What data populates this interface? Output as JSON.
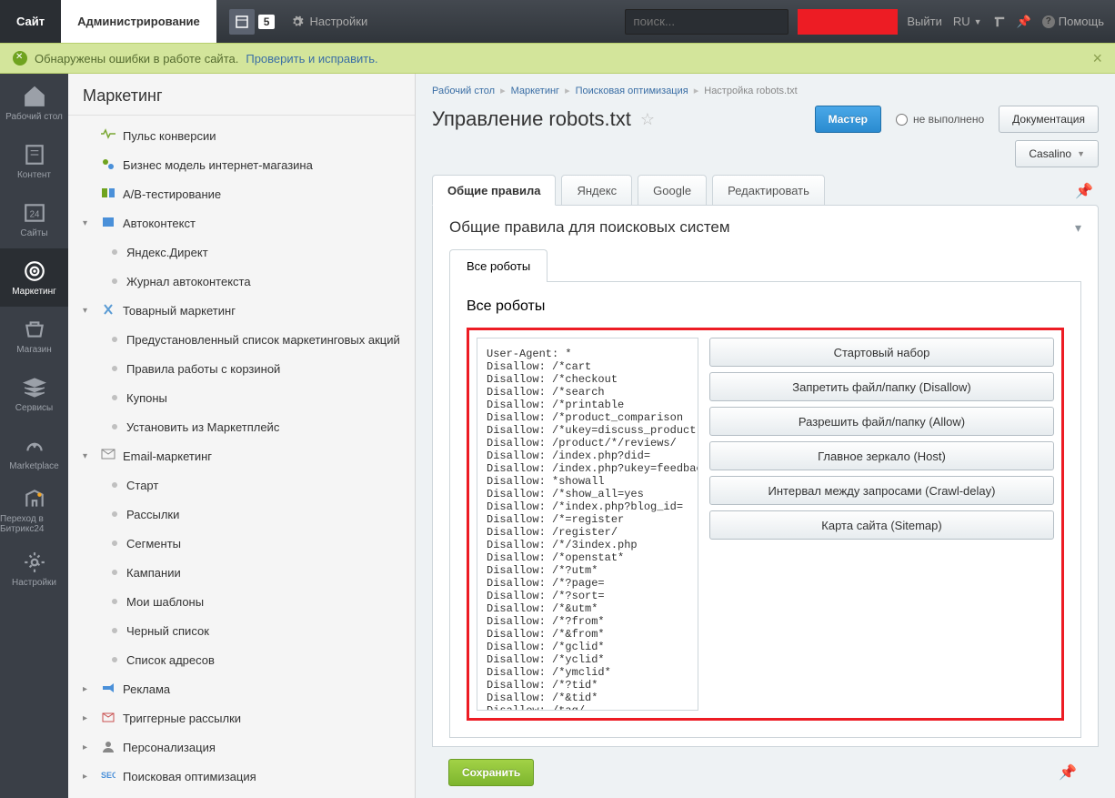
{
  "topbar": {
    "site_tab": "Сайт",
    "admin_tab": "Администрирование",
    "notif_count": "5",
    "settings": "Настройки",
    "search_placeholder": "поиск...",
    "logout": "Выйти",
    "lang": "RU",
    "help": "Помощь"
  },
  "alert": {
    "text": "Обнаружены ошибки в работе сайта.",
    "link": "Проверить и исправить."
  },
  "iconbar": [
    {
      "label": "Рабочий стол"
    },
    {
      "label": "Контент"
    },
    {
      "label": "Сайты"
    },
    {
      "label": "Маркетинг"
    },
    {
      "label": "Магазин"
    },
    {
      "label": "Сервисы"
    },
    {
      "label": "Marketplace"
    },
    {
      "label": "Переход в Битрикс24"
    },
    {
      "label": "Настройки"
    }
  ],
  "sidebar": {
    "title": "Маркетинг",
    "items": [
      {
        "level": 1,
        "icon": "pulse",
        "label": "Пульс конверсии",
        "exp": ""
      },
      {
        "level": 1,
        "icon": "biz",
        "label": "Бизнес модель интернет-магазина",
        "exp": ""
      },
      {
        "level": 1,
        "icon": "ab",
        "label": "A/B-тестирование",
        "exp": ""
      },
      {
        "level": 1,
        "icon": "auto",
        "label": "Автоконтекст",
        "exp": "▾"
      },
      {
        "level": 2,
        "icon": "",
        "label": "Яндекс.Директ",
        "exp": ""
      },
      {
        "level": 2,
        "icon": "",
        "label": "Журнал автоконтекста",
        "exp": ""
      },
      {
        "level": 1,
        "icon": "tools",
        "label": "Товарный маркетинг",
        "exp": "▾"
      },
      {
        "level": 2,
        "icon": "",
        "label": "Предустановленный список маркетинговых акций",
        "exp": ""
      },
      {
        "level": 2,
        "icon": "",
        "label": "Правила работы с корзиной",
        "exp": ""
      },
      {
        "level": 2,
        "icon": "",
        "label": "Купоны",
        "exp": ""
      },
      {
        "level": 2,
        "icon": "",
        "label": "Установить из Маркетплейс",
        "exp": ""
      },
      {
        "level": 1,
        "icon": "mail",
        "label": "Email-маркетинг",
        "exp": "▾"
      },
      {
        "level": 2,
        "icon": "",
        "label": "Старт",
        "exp": ""
      },
      {
        "level": 2,
        "icon": "",
        "label": "Рассылки",
        "exp": ""
      },
      {
        "level": 2,
        "icon": "",
        "label": "Сегменты",
        "exp": ""
      },
      {
        "level": 2,
        "icon": "",
        "label": "Кампании",
        "exp": ""
      },
      {
        "level": 2,
        "icon": "",
        "label": "Мои шаблоны",
        "exp": ""
      },
      {
        "level": 2,
        "icon": "",
        "label": "Черный список",
        "exp": ""
      },
      {
        "level": 2,
        "icon": "",
        "label": "Список адресов",
        "exp": ""
      },
      {
        "level": 1,
        "icon": "ads",
        "label": "Реклама",
        "exp": "▸"
      },
      {
        "level": 1,
        "icon": "trig",
        "label": "Триггерные рассылки",
        "exp": "▸"
      },
      {
        "level": 1,
        "icon": "pers",
        "label": "Персонализация",
        "exp": "▸"
      },
      {
        "level": 1,
        "icon": "seo",
        "label": "Поисковая оптимизация",
        "exp": "▸"
      }
    ]
  },
  "breadcrumb": [
    {
      "label": "Рабочий стол",
      "link": true
    },
    {
      "label": "Маркетинг",
      "link": true
    },
    {
      "label": "Поисковая оптимизация",
      "link": true
    },
    {
      "label": "Настройка robots.txt",
      "link": false
    }
  ],
  "page": {
    "title": "Управление robots.txt",
    "master_btn": "Мастер",
    "status_label": "не выполнено",
    "doc_btn": "Документация",
    "site_dd": "Casalino"
  },
  "tabs": {
    "items": [
      "Общие правила",
      "Яндекс",
      "Google",
      "Редактировать"
    ],
    "active": 0
  },
  "panel": {
    "title": "Общие правила для поисковых систем",
    "inner_tab": "Все роботы",
    "section_title": "Все роботы"
  },
  "robots_txt": "User-Agent: *\nDisallow: /*cart\nDisallow: /*checkout\nDisallow: /*search\nDisallow: /*printable\nDisallow: /*product_comparison\nDisallow: /*ukey=discuss_product*\nDisallow: /product/*/reviews/\nDisallow: /index.php?did=\nDisallow: /index.php?ukey=feedback\nDisallow: *showall\nDisallow: /*show_all=yes\nDisallow: /*index.php?blog_id=\nDisallow: /*=register\nDisallow: /register/\nDisallow: /*/3index.php\nDisallow: /*openstat*\nDisallow: /*?utm*\nDisallow: /*?page=\nDisallow: /*?sort=\nDisallow: /*&utm*\nDisallow: /*?from*\nDisallow: /*&from*\nDisallow: /*gclid*\nDisallow: /*yclid*\nDisallow: /*ymclid*\nDisallow: /*?tid*\nDisallow: /*&tid*\nDisallow: /tag/\nDisallow: /my-account/\nDisallow: /logout/",
  "action_buttons": [
    "Стартовый набор",
    "Запретить файл/папку (Disallow)",
    "Разрешить файл/папку (Allow)",
    "Главное зеркало (Host)",
    "Интервал между запросами (Crawl-delay)",
    "Карта сайта (Sitemap)"
  ],
  "bottom": {
    "save": "Сохранить"
  }
}
